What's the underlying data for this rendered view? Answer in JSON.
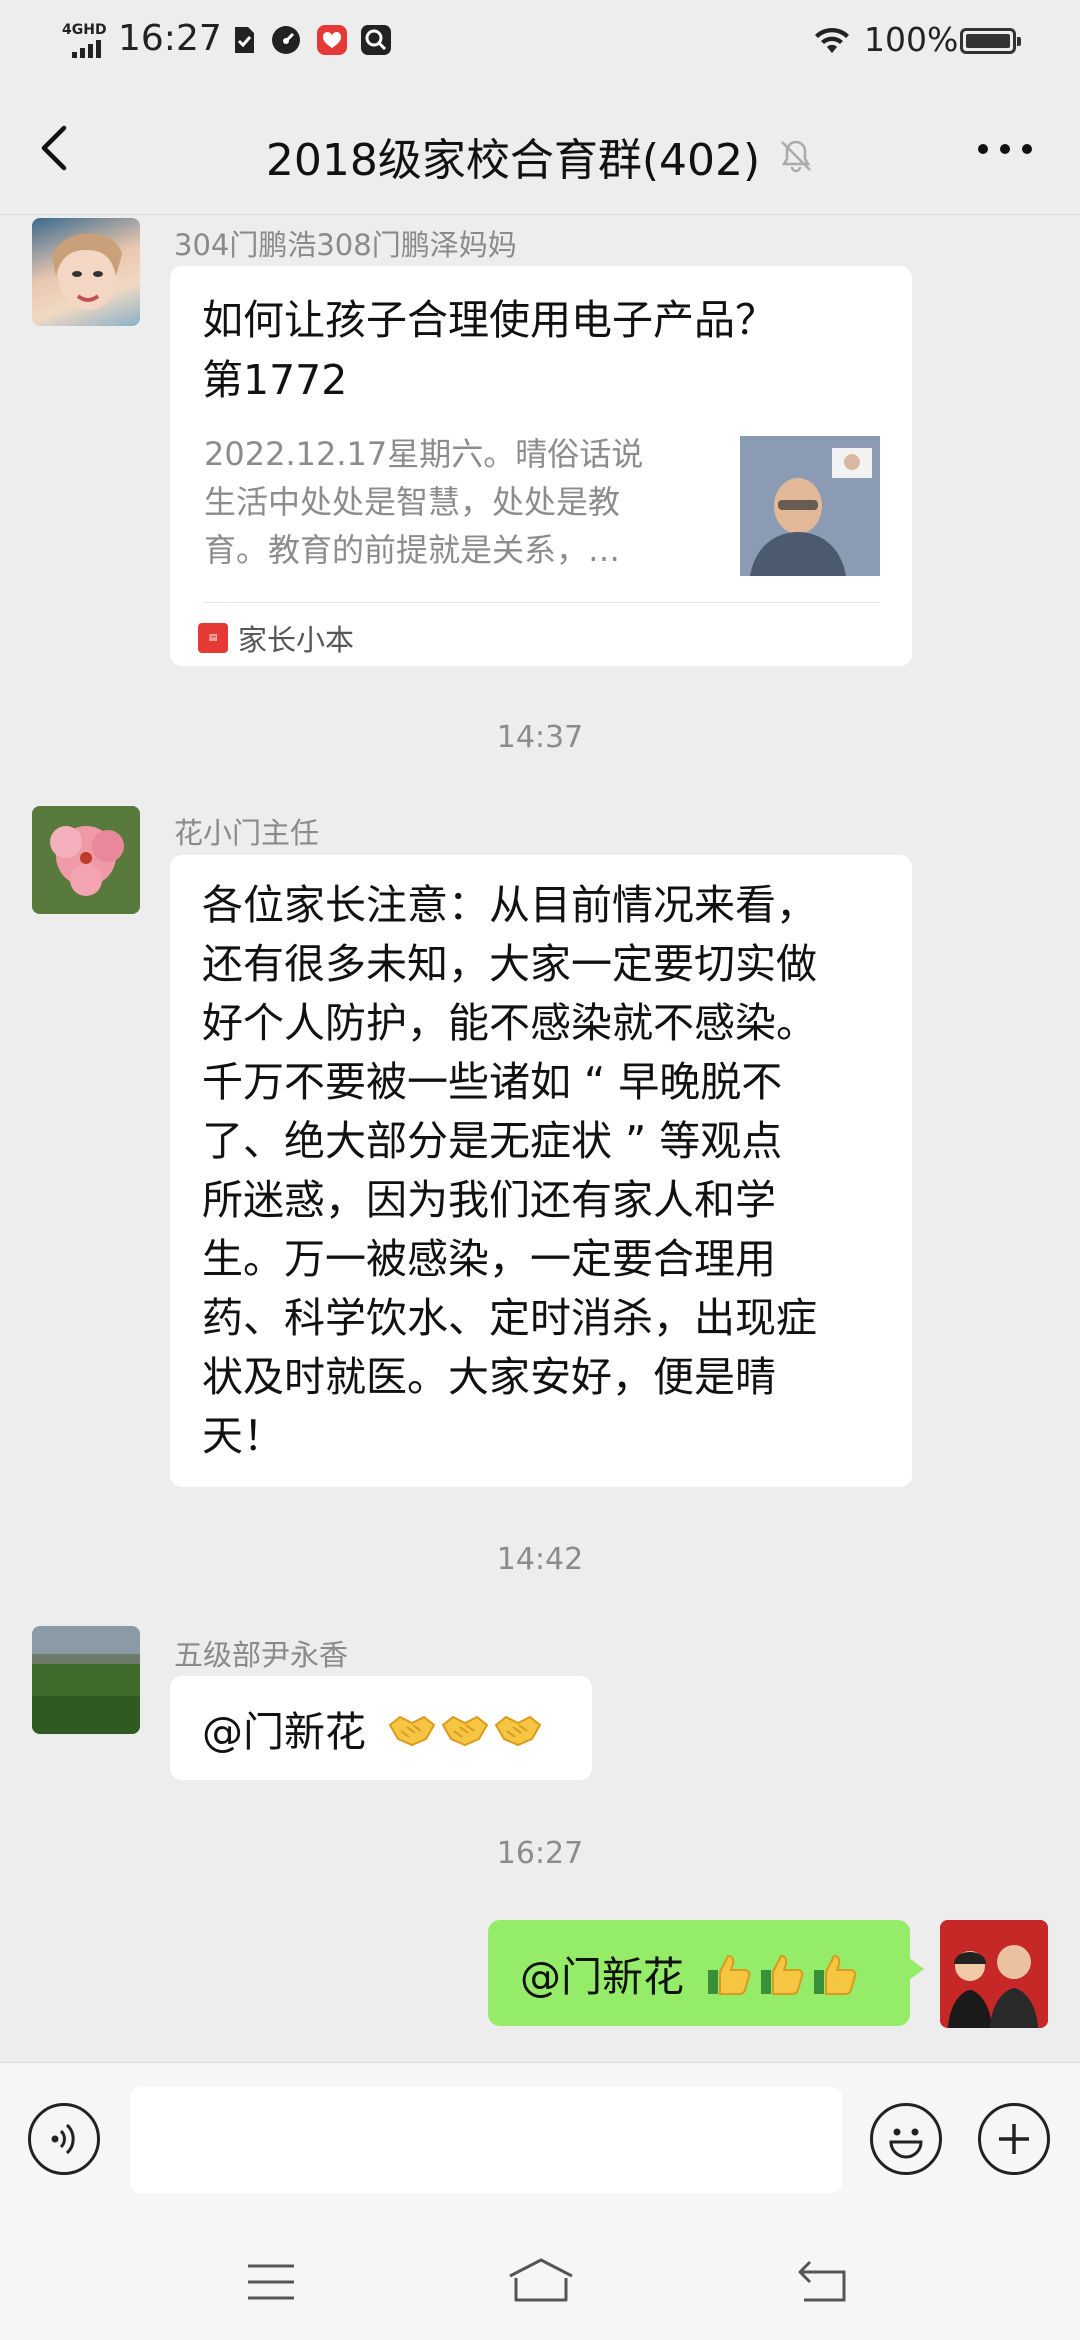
{
  "status_bar": {
    "network": "4GHD",
    "time": "16:27",
    "battery_text": "100%",
    "icons": [
      "sim-card-icon",
      "speedometer-icon",
      "app-badge-icon",
      "search-app-icon",
      "wifi-icon",
      "battery-icon"
    ]
  },
  "header": {
    "title": "2018级家校合育群(402)",
    "muted_icon": "bell-off-icon",
    "back_icon": "chevron-left-icon",
    "more_icon": "more-dots-icon"
  },
  "messages": [
    {
      "type": "link",
      "sender": "304门鹏浩308门鹏泽妈妈",
      "title_lines": [
        "如何让孩子合理使用电子产品？",
        "第1772"
      ],
      "desc_lines": [
        "2022.12.17星期六。晴俗话说",
        "生活中处处是智慧，处处是教",
        "育。教育的前提就是关系，…"
      ],
      "source": "家长小本",
      "source_logo_text": "家长小本"
    },
    {
      "type": "time",
      "text": "14:37"
    },
    {
      "type": "text",
      "sender": "花小门主任",
      "lines": [
        "各位家长注意：从目前情况来看，",
        "还有很多未知，大家一定要切实做",
        "好个人防护，能不感染就不感染。",
        "千万不要被一些诸如 “ 早晚脱不",
        "了、绝大部分是无症状 ” 等观点",
        "所迷惑，因为我们还有家人和学",
        "生。万一被感染，一定要合理用",
        "药、科学饮水、定时消杀，出现症",
        "状及时就医。大家安好，便是晴",
        "天！"
      ]
    },
    {
      "type": "time",
      "text": "14:42"
    },
    {
      "type": "text",
      "sender": "五级部尹永香",
      "mention": "@门新花",
      "emojis": [
        "handshake-emoji",
        "handshake-emoji",
        "handshake-emoji"
      ]
    },
    {
      "type": "time",
      "text": "16:27"
    },
    {
      "type": "self",
      "mention": "@门新花",
      "emojis": [
        "thumbs-up-emoji",
        "thumbs-up-emoji",
        "thumbs-up-emoji"
      ]
    }
  ],
  "input_bar": {
    "voice_icon": "voice-input-icon",
    "emoji_icon": "emoji-icon",
    "plus_icon": "plus-circle-icon",
    "value": "",
    "placeholder": ""
  },
  "nav_bar": {
    "icons": [
      "menu-icon",
      "home-icon",
      "back-nav-icon"
    ]
  },
  "colors": {
    "background": "#ededed",
    "bubble_self": "#95ec69",
    "bubble_other": "#ffffff",
    "source_logo": "#e53935"
  }
}
